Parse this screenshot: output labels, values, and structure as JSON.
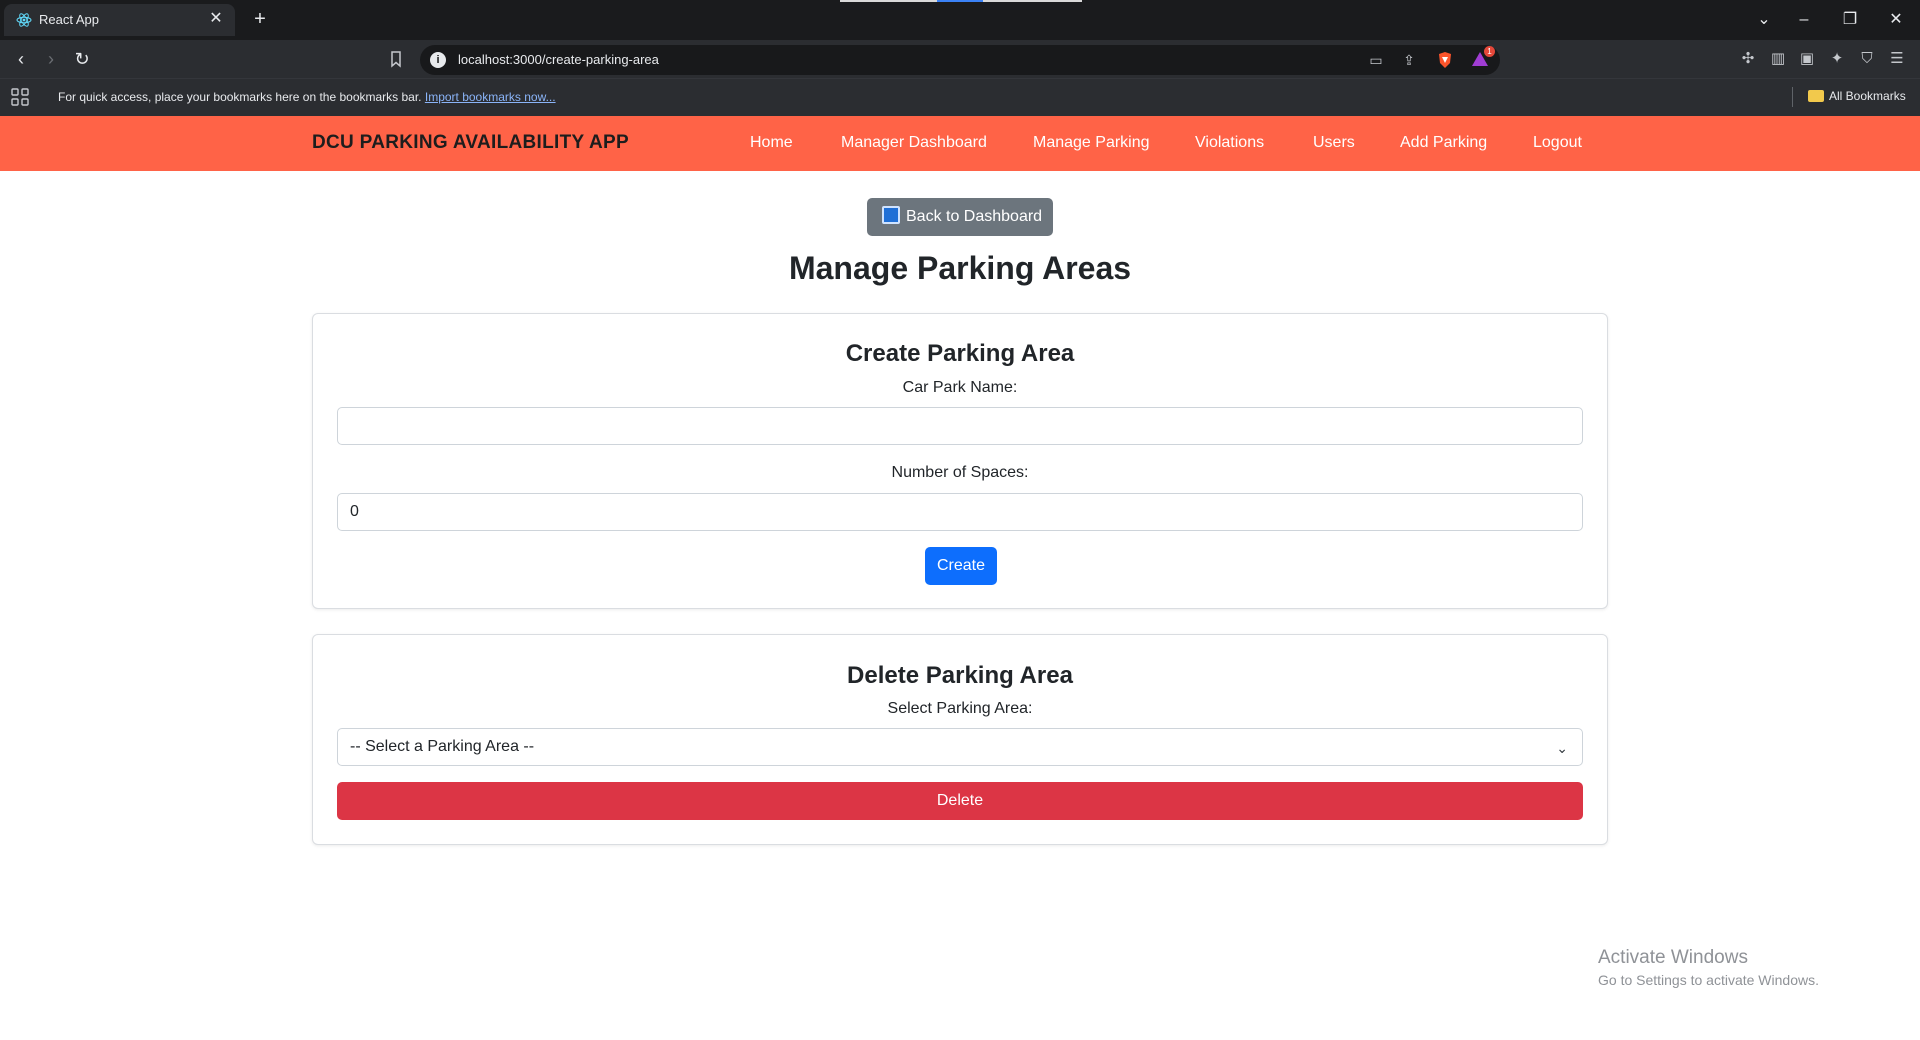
{
  "browser": {
    "tab_title": "React App",
    "tab_close": "✕",
    "new_tab": "+",
    "url": "localhost:3000/create-parking-area",
    "bookmarks_bar_text": "For quick access, place your bookmarks here on the bookmarks bar.",
    "import_bookmarks_link": "Import bookmarks now...",
    "all_bookmarks": "All Bookmarks",
    "rewards_badge": "1",
    "icons": [
      "react-favicon",
      "back-icon",
      "forward-icon",
      "reload-icon",
      "bookmark-icon",
      "site-info-icon",
      "cast-icon",
      "share-icon",
      "brave-shields-icon",
      "brave-rewards-icon",
      "extensions-icon",
      "sidebar-icon",
      "wallet-icon",
      "leo-ai-icon",
      "vpn-icon",
      "menu-icon",
      "apps-icon",
      "folder-icon"
    ]
  },
  "navbar": {
    "brand": "DCU PARKING AVAILABILITY APP",
    "links": [
      "Home",
      "Manager Dashboard",
      "Manage Parking",
      "Violations",
      "Users",
      "Add Parking",
      "Logout"
    ],
    "color": "#ff6347"
  },
  "page": {
    "back_button": "Back to Dashboard",
    "title": "Manage Parking Areas"
  },
  "create_card": {
    "title": "Create Parking Area",
    "name_label": "Car Park Name:",
    "name_value": "",
    "spaces_label": "Number of Spaces:",
    "spaces_value": "0",
    "create_button": "Create"
  },
  "delete_card": {
    "title": "Delete Parking Area",
    "select_label": "Select Parking Area:",
    "select_value": "-- Select a Parking Area --",
    "delete_button": "Delete"
  },
  "watermark": {
    "title": "Activate Windows",
    "subtitle": "Go to Settings to activate Windows."
  },
  "colors": {
    "primary": "#0d6efd",
    "danger": "#dc3545",
    "secondary": "#6c757d"
  }
}
